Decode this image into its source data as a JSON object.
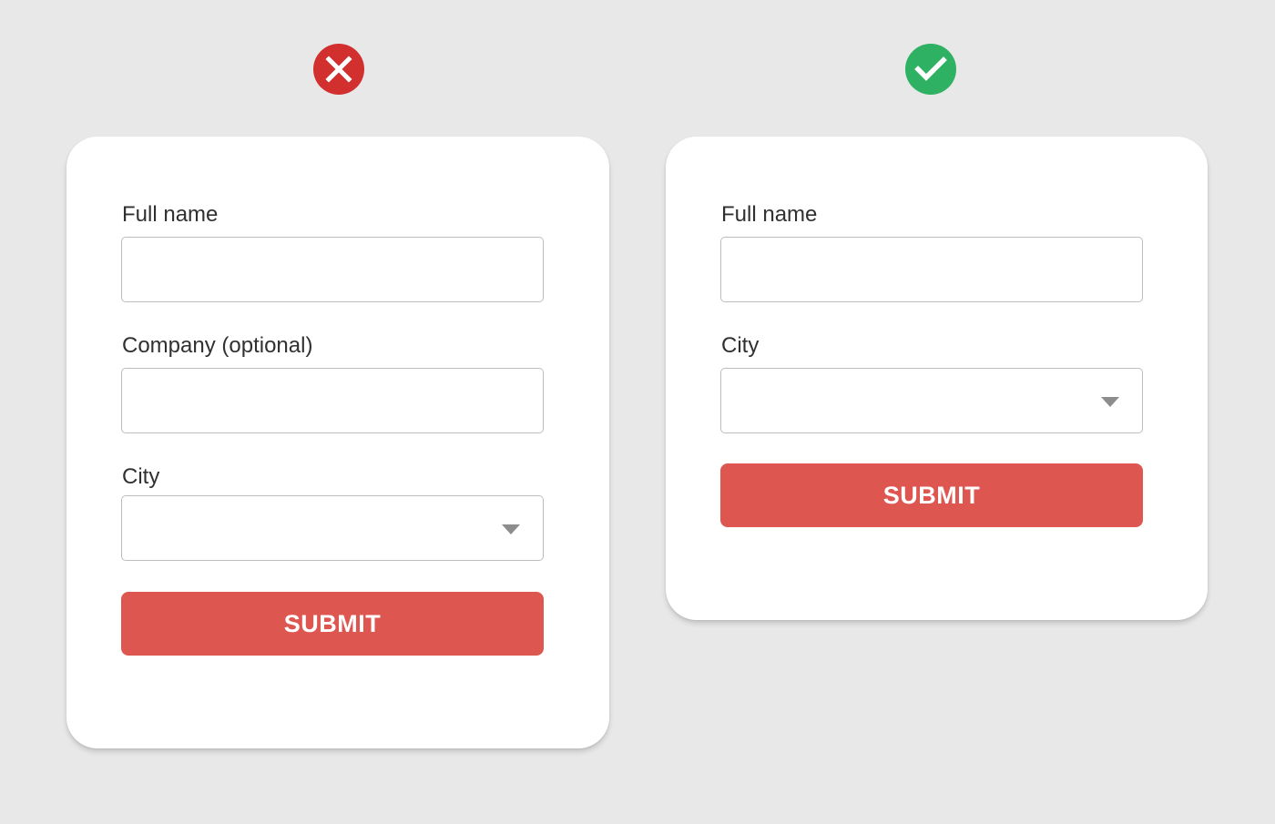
{
  "colors": {
    "background": "#e8e8e8",
    "card": "#ffffff",
    "submit": "#de5650",
    "bad_badge": "#d22f2f",
    "good_badge": "#2fb163"
  },
  "bad_example": {
    "icon": "x-circle-icon",
    "fields": [
      {
        "label": "Full name",
        "value": ""
      },
      {
        "label": "Company (optional)",
        "value": ""
      },
      {
        "label": "City",
        "value": ""
      }
    ],
    "submit_label": "SUBMIT"
  },
  "good_example": {
    "icon": "check-circle-icon",
    "fields": [
      {
        "label": "Full name",
        "value": ""
      },
      {
        "label": "City",
        "value": ""
      }
    ],
    "submit_label": "SUBMIT"
  }
}
